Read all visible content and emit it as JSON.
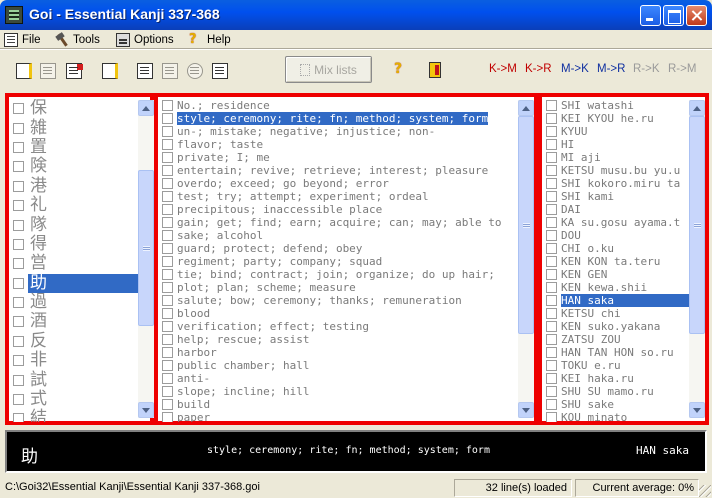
{
  "window": {
    "title": "Goi - Essential Kanji 337-368"
  },
  "menu": {
    "file": "File",
    "tools": "Tools",
    "options": "Options",
    "help": "Help"
  },
  "toolbar": {
    "mix_label": "Mix lists",
    "help_glyph": "?",
    "directions": [
      "K->M",
      "K->R",
      "M->K",
      "M->R",
      "R->K",
      "R->M"
    ],
    "direction_colors": [
      "#c00000",
      "#c00000",
      "#1030a0",
      "#1030a0",
      "#9a9a9a",
      "#9a9a9a"
    ]
  },
  "kanji_list": {
    "items": [
      "保",
      "雑",
      "置",
      "険",
      "港",
      "礼",
      "隊",
      "得",
      "営",
      "助",
      "過",
      "酒",
      "反",
      "非",
      "試",
      "式",
      "結"
    ],
    "selected": 9
  },
  "meaning_list": {
    "items": [
      "No.; residence",
      "style; ceremony; rite; fn; method; system; form",
      "un-; mistake; negative; injustice; non-",
      "flavor; taste",
      "private; I; me",
      "entertain; revive; retrieve; interest; pleasure",
      "overdo; exceed; go beyond; error",
      "test; try; attempt; experiment; ordeal",
      "precipitous; inaccessible place",
      "gain; get; find; earn; acquire; can; may; able to",
      "sake; alcohol",
      "guard; protect; defend; obey",
      "regiment; party; company; squad",
      "tie; bind; contract; join; organize; do up hair;",
      "plot; plan; scheme; measure",
      "salute; bow; ceremony; thanks; remuneration",
      "blood",
      "verification; effect; testing",
      "help; rescue; assist",
      "harbor",
      "public chamber; hall",
      "anti-",
      "slope; incline; hill",
      "build",
      "paper"
    ],
    "selected": 1
  },
  "reading_list": {
    "items": [
      "SHI watashi",
      "KEI KYOU he.ru",
      "KYUU",
      "HI",
      "MI aji",
      "KETSU musu.bu yu.u",
      "SHI kokoro.miru ta",
      "SHI kami",
      "DAI",
      "KA su.gosu ayama.t",
      "DOU",
      "CHI o.ku",
      "KEN KON ta.teru",
      "KEN GEN",
      "KEN kewa.shii",
      "HAN saka",
      "KETSU chi",
      "KEN suko.yakana",
      "ZATSU ZOU",
      "HAN TAN HON so.ru",
      "TOKU e.ru",
      "KEI haka.ru",
      "SHU SU mamo.ru",
      "SHU sake",
      "KOU minato"
    ],
    "selected": 15
  },
  "info": {
    "kanji": "助",
    "meaning": "style; ceremony; rite; fn; method; system; form",
    "reading": "HAN saka"
  },
  "status": {
    "path": "C:\\Goi32\\Essential Kanji\\Essential Kanji 337-368.goi",
    "lines": "32 line(s) loaded",
    "average": "Current average: 0%"
  }
}
